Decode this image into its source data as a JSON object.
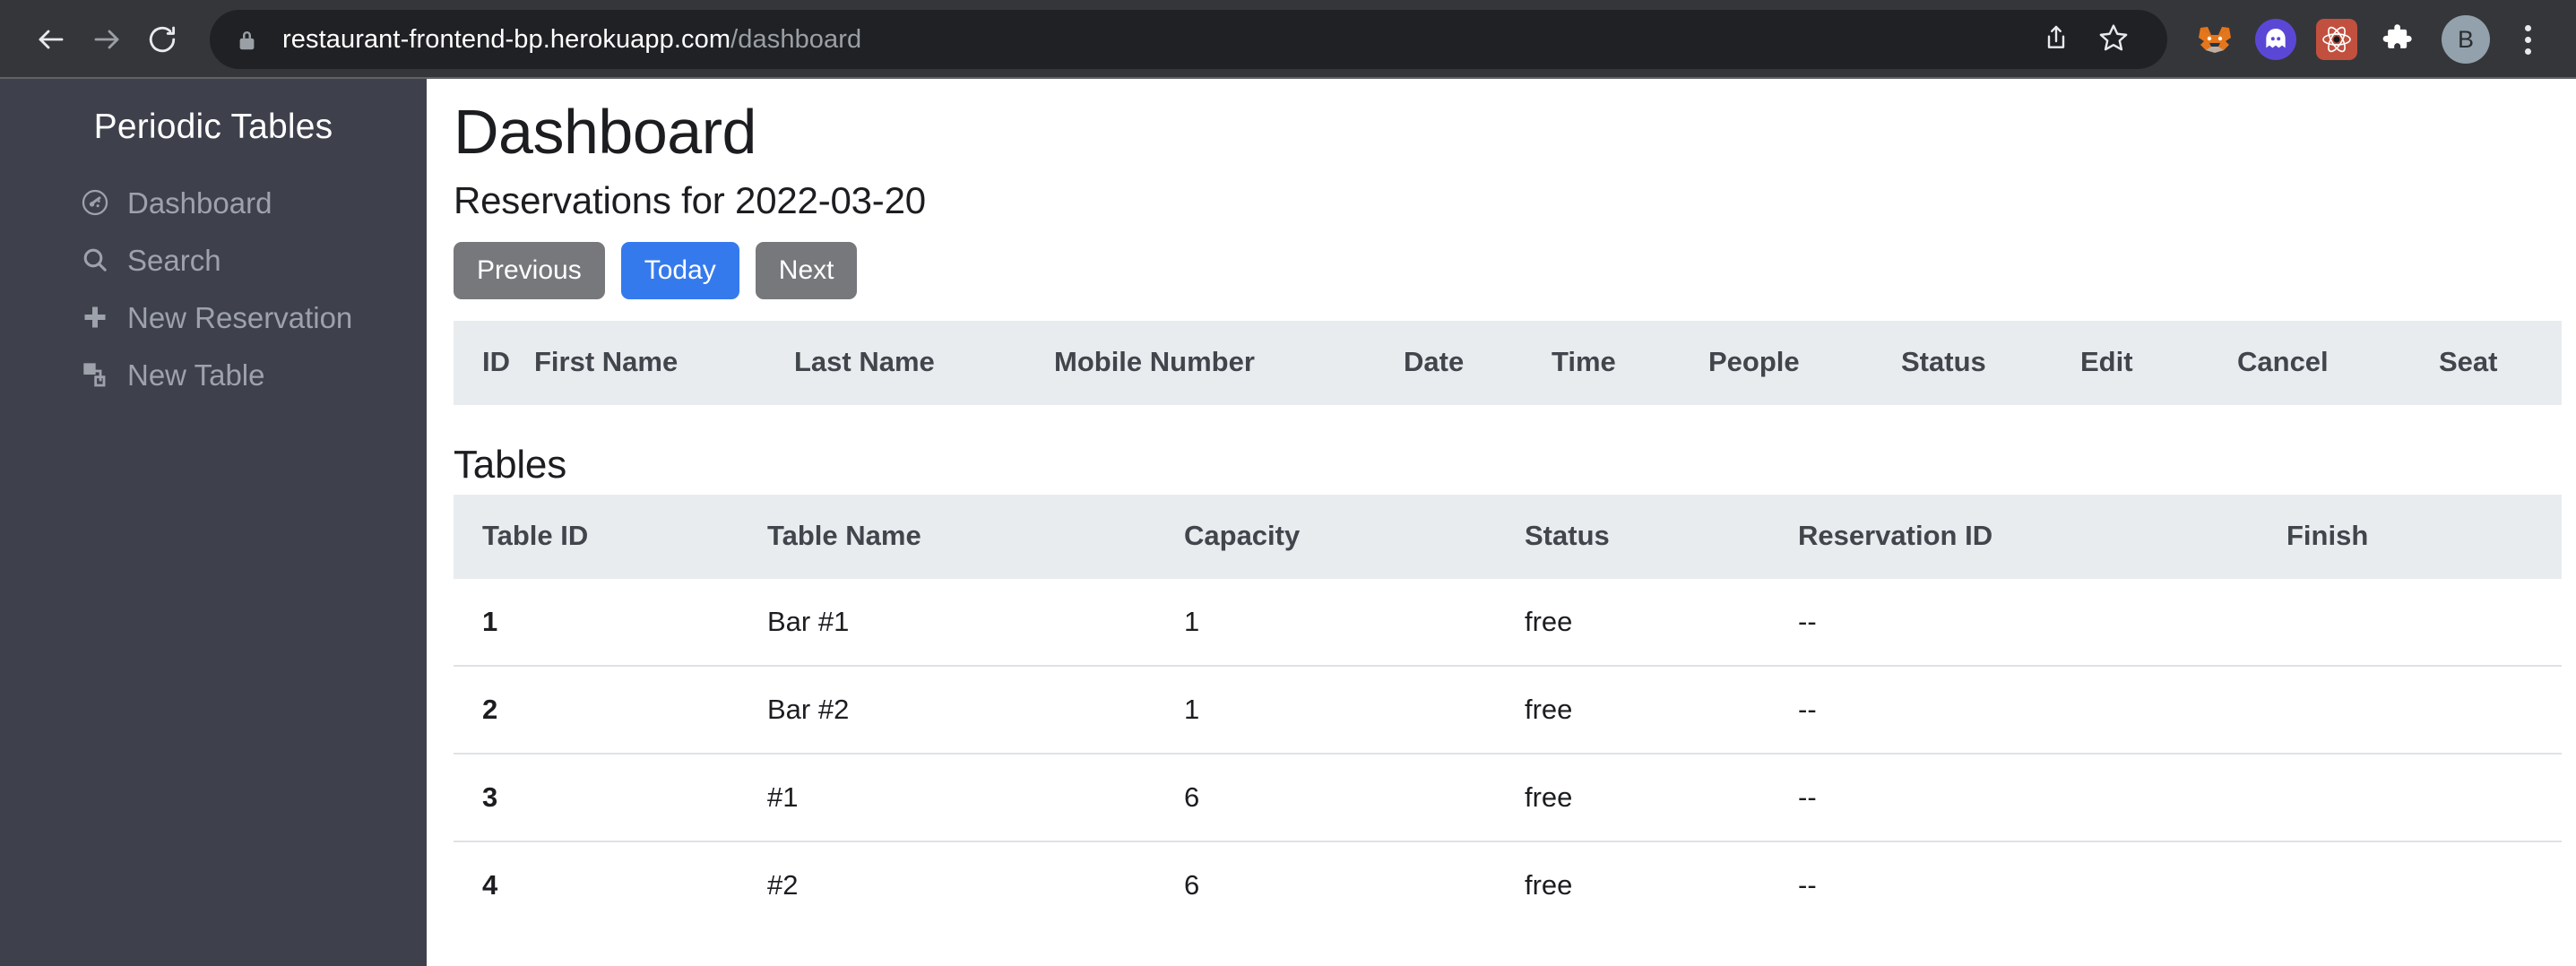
{
  "browser": {
    "back_icon": "back-arrow-icon",
    "forward_icon": "forward-arrow-icon",
    "reload_icon": "reload-icon",
    "lock_icon": "lock-icon",
    "url_host": "restaurant-frontend-bp.herokuapp.com",
    "url_path": "/dashboard",
    "share_icon": "share-icon",
    "bookmark_icon": "star-icon",
    "extensions": [
      {
        "name": "metamask-extension-icon",
        "glyph": "🦊"
      },
      {
        "name": "phantom-wallet-extension-icon",
        "glyph": "👻"
      },
      {
        "name": "react-devtools-extension-icon",
        "glyph": "⚛"
      },
      {
        "name": "extensions-puzzle-icon",
        "glyph": "🧩"
      }
    ],
    "profile_initial": "B",
    "menu_icon": "three-dot-menu-icon"
  },
  "sidebar": {
    "title": "Periodic Tables",
    "items": [
      {
        "label": "Dashboard",
        "icon": "dashboard-gauge-icon"
      },
      {
        "label": "Search",
        "icon": "search-icon"
      },
      {
        "label": "New Reservation",
        "icon": "plus-icon"
      },
      {
        "label": "New Table",
        "icon": "layers-icon"
      }
    ]
  },
  "main": {
    "page_title": "Dashboard",
    "subtitle": "Reservations for 2022-03-20",
    "date": "2022-03-20",
    "buttons": {
      "previous": "Previous",
      "today": "Today",
      "next": "Next"
    },
    "reservations": {
      "headers": [
        "ID",
        "First Name",
        "Last Name",
        "Mobile Number",
        "Date",
        "Time",
        "People",
        "Status",
        "Edit",
        "Cancel",
        "Seat"
      ],
      "rows": []
    },
    "tables_section": {
      "heading": "Tables",
      "headers": [
        "Table ID",
        "Table Name",
        "Capacity",
        "Status",
        "Reservation ID",
        "Finish"
      ],
      "rows": [
        {
          "table_id": "1",
          "table_name": "Bar #1",
          "capacity": "1",
          "status": "free",
          "reservation_id": "--",
          "finish": ""
        },
        {
          "table_id": "2",
          "table_name": "Bar #2",
          "capacity": "1",
          "status": "free",
          "reservation_id": "--",
          "finish": ""
        },
        {
          "table_id": "3",
          "table_name": "#1",
          "capacity": "6",
          "status": "free",
          "reservation_id": "--",
          "finish": ""
        },
        {
          "table_id": "4",
          "table_name": "#2",
          "capacity": "6",
          "status": "free",
          "reservation_id": "--",
          "finish": ""
        }
      ]
    }
  },
  "colors": {
    "sidebar_bg": "#3e414c",
    "chrome_bg": "#35363a",
    "omnibox_bg": "#202124",
    "primary": "#357aed",
    "secondary": "#76787c",
    "table_header_bg": "#e9ecef"
  }
}
